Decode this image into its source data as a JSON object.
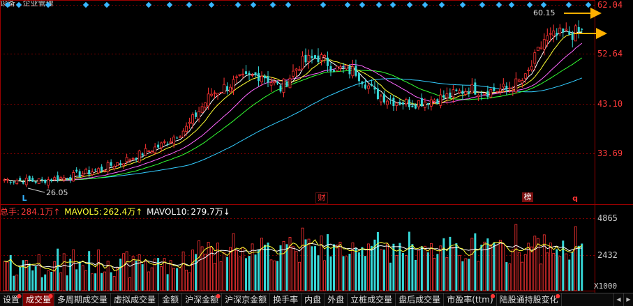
{
  "title_fragment": "设备 · 企业管理",
  "price_axis": {
    "labels": [
      "62.04",
      "52.64",
      "43.10",
      "33.69"
    ],
    "values": [
      62.04,
      52.64,
      43.1,
      33.69
    ],
    "min": 22.5,
    "max": 62.04
  },
  "annotations": {
    "high_price": "60.15",
    "low_price": "26.05",
    "marker_cai": "财",
    "marker_bang": "榜",
    "marker_q": "q",
    "marker_l": "L"
  },
  "volume_legend": {
    "total_label": "总手:",
    "total_value": "284.1万↑",
    "ma5_label": "MAVOL5:",
    "ma5_value": "262.4万↑",
    "ma10_label": "MAVOL10:",
    "ma10_value": "279.7万↓"
  },
  "volume_axis": {
    "labels": [
      "4865",
      "2432",
      "X1000"
    ],
    "values": [
      4865,
      2432
    ],
    "unit": "X1000"
  },
  "tabs": [
    {
      "label": "设置",
      "dot": true,
      "active": false
    },
    {
      "label": "成交量",
      "dot": true,
      "active": true
    },
    {
      "label": "多周期成交量",
      "dot": false,
      "active": false
    },
    {
      "label": "虚拟成交量",
      "dot": false,
      "active": false
    },
    {
      "label": "金额",
      "dot": false,
      "active": false
    },
    {
      "label": "沪深金额",
      "dot": true,
      "active": false
    },
    {
      "label": "沪深京金额",
      "dot": false,
      "active": false
    },
    {
      "label": "换手率",
      "dot": false,
      "active": false
    },
    {
      "label": "内盘",
      "dot": false,
      "active": false
    },
    {
      "label": "外盘",
      "dot": false,
      "active": false
    },
    {
      "label": "立桩成交量",
      "dot": false,
      "active": false
    },
    {
      "label": "盘后成交量",
      "dot": false,
      "active": false
    },
    {
      "label": "市盈率(ttm)",
      "dot": true,
      "active": false
    },
    {
      "label": "陆股通持股变化",
      "dot": true,
      "active": false
    }
  ],
  "colors": {
    "up": "#ff3333",
    "down": "#36d7d7",
    "ma5": "#ffffff",
    "ma10": "#ffff33",
    "ma20": "#ff66ff",
    "ma30": "#33ff33",
    "ma60": "#33ccff",
    "arrow": "#ffb000",
    "diamond": "#37b6ff"
  },
  "chart_data": {
    "type": "candlestick",
    "price_range": [
      22.5,
      62.04
    ],
    "volume_range": [
      0,
      5400
    ],
    "anchor_points": [
      {
        "i": 0,
        "close": 26.5
      },
      {
        "i": 10,
        "close": 26.2
      },
      {
        "i": 20,
        "close": 27.0
      },
      {
        "i": 30,
        "close": 28.5
      },
      {
        "i": 40,
        "close": 30.8
      },
      {
        "i": 50,
        "close": 33.5
      },
      {
        "i": 58,
        "close": 37.0
      },
      {
        "i": 66,
        "close": 44.0
      },
      {
        "i": 74,
        "close": 46.5
      },
      {
        "i": 82,
        "close": 48.0
      },
      {
        "i": 88,
        "close": 45.0
      },
      {
        "i": 94,
        "close": 50.0
      },
      {
        "i": 100,
        "close": 51.5
      },
      {
        "i": 106,
        "close": 49.0
      },
      {
        "i": 112,
        "close": 48.5
      },
      {
        "i": 118,
        "close": 44.0
      },
      {
        "i": 124,
        "close": 42.5
      },
      {
        "i": 130,
        "close": 42.0
      },
      {
        "i": 136,
        "close": 42.8
      },
      {
        "i": 142,
        "close": 43.5
      },
      {
        "i": 148,
        "close": 45.0
      },
      {
        "i": 154,
        "close": 44.5
      },
      {
        "i": 160,
        "close": 45.0
      },
      {
        "i": 166,
        "close": 47.0
      },
      {
        "i": 172,
        "close": 55.0
      },
      {
        "i": 178,
        "close": 56.0
      },
      {
        "i": 184,
        "close": 56.5
      }
    ],
    "candle_count": 185,
    "volume_ma_labels": [
      "MAVOL5",
      "MAVOL10"
    ]
  }
}
